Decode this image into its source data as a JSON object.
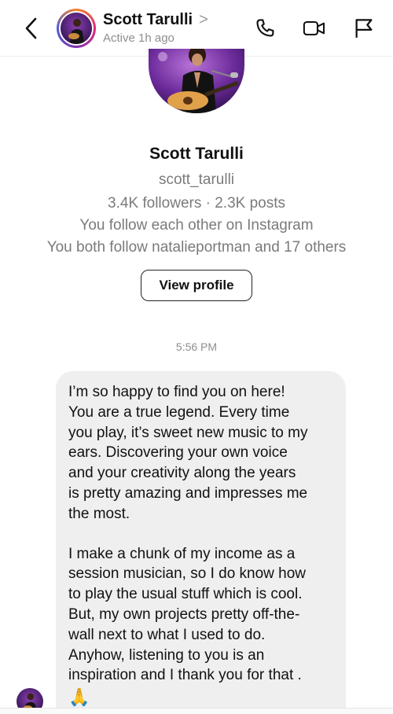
{
  "header": {
    "name": "Scott Tarulli",
    "chevron": ">",
    "status": "Active 1h ago",
    "icons": {
      "back": "chevron-left-icon",
      "call": "phone-icon",
      "video": "video-camera-icon",
      "report": "flag-icon"
    }
  },
  "profile": {
    "name": "Scott Tarulli",
    "username": "scott_tarulli",
    "stats": "3.4K followers · 2.3K posts",
    "mutual_follow": "You follow each other on Instagram",
    "mutual_friends": "You both follow natalieportman and 17 others",
    "view_profile_label": "View profile"
  },
  "chat": {
    "timestamp": "5:56 PM",
    "message": {
      "para1_lines": [
        "I’m so happy to find you on here!",
        "You are a true legend. Every time",
        "you play, it’s sweet new music to my",
        "ears. Discovering your own voice",
        "and your creativity along the years",
        "is pretty amazing and impresses me",
        "the most."
      ],
      "para2_lines": [
        "I make a chunk of my income as a",
        "session musician, so I do know how",
        "to play the usual stuff which is cool.",
        "But, my own projects pretty off-the-",
        "wall next to what I used to do.",
        "Anyhow, listening to you is an",
        "inspiration and I thank you for that ."
      ],
      "emoji": "🙏"
    }
  },
  "colors": {
    "secondary_text": "#7a7a7a",
    "bubble": "#efefef",
    "story_ring": "#dd2a7b"
  }
}
